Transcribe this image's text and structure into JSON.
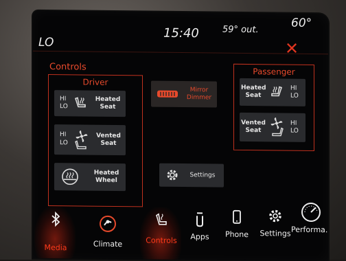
{
  "status": {
    "driver_temp": "LO",
    "time": "15:40",
    "outside_temp": "59° out.",
    "passenger_temp": "60°"
  },
  "controls_title": "Controls",
  "driver": {
    "label": "Driver",
    "heated_seat": {
      "hi": "HI",
      "lo": "LO",
      "label_1": "Heated",
      "label_2": "Seat"
    },
    "vented_seat": {
      "hi": "HI",
      "lo": "LO",
      "label_1": "Vented",
      "label_2": "Seat"
    },
    "heated_wheel": {
      "label_1": "Heated",
      "label_2": "Wheel"
    }
  },
  "center": {
    "mirror_dimmer": {
      "label_1": "Mirror",
      "label_2": "Dimmer"
    },
    "settings": {
      "label": "Settings"
    }
  },
  "passenger": {
    "label": "Passenger",
    "heated_seat": {
      "hi": "HI",
      "lo": "LO",
      "label_1": "Heated",
      "label_2": "Seat"
    },
    "vented_seat": {
      "hi": "HI",
      "lo": "LO",
      "label_1": "Vented",
      "label_2": "Seat"
    }
  },
  "nav": [
    {
      "label": "Media",
      "icon": "bluetooth-icon",
      "active": true
    },
    {
      "label": "Climate",
      "icon": "climate-icon",
      "active": false
    },
    {
      "label": "Controls",
      "icon": "controls-icon",
      "active": true
    },
    {
      "label": "Apps",
      "icon": "apps-icon",
      "active": false
    },
    {
      "label": "Phone",
      "icon": "phone-icon",
      "active": false
    },
    {
      "label": "Settings",
      "icon": "gear-icon",
      "active": false
    },
    {
      "label": "Performa...",
      "icon": "gauge-icon",
      "active": false
    }
  ],
  "colors": {
    "accent": "#e84a2c",
    "panel_border": "#c0311e",
    "tile_bg": "#2a2b2e"
  }
}
